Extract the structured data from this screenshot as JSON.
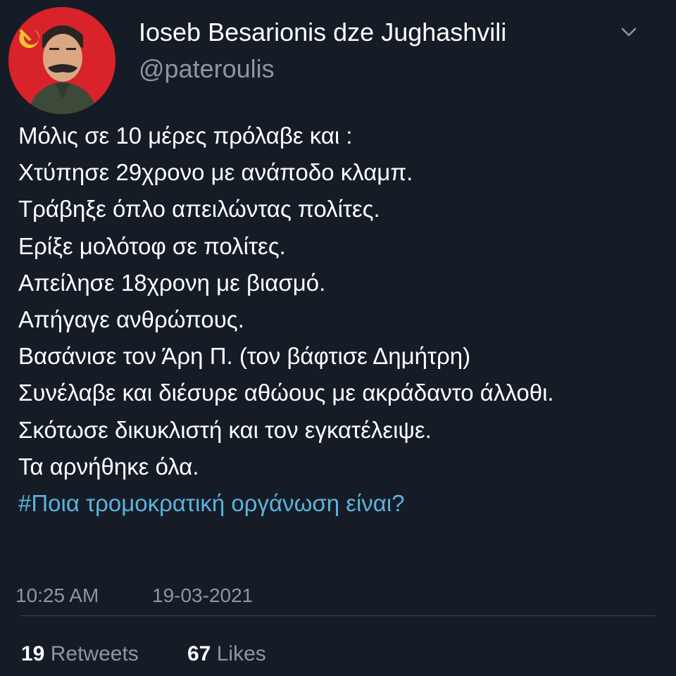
{
  "author": {
    "display_name": "Ioseb Besarionis dze Jughashvili",
    "handle": "@pateroulis",
    "avatar_icon": "profile-portrait-red-background"
  },
  "tweet": {
    "lines": [
      "Μόλις σε 10 μέρες πρόλαβε και :",
      "Χτύπησε 29χρονο με ανάποδο κλαμπ.",
      "Τράβηξε όπλο απειλώντας πολίτες.",
      "Ερίξε μολότοφ σε πολίτες.",
      "Απείλησε 18χρονη με βιασμό.",
      "Απήγαγε ανθρώπους.",
      "Βασάνισε τον Άρη Π. (τον βάφτισε Δημήτρη)",
      "Συνέλαβε και διέσυρε αθώους με ακράδαντο άλλοθι.",
      "Σκότωσε δικυκλιστή και τον εγκατέλειψε.",
      "Τα αρνήθηκε όλα."
    ],
    "hashtag": "#Ποια τρομοκρατική οργάνωση είναι?"
  },
  "meta": {
    "time": "10:25 AM",
    "date": "19-03-2021"
  },
  "stats": {
    "retweets_count": "19",
    "retweets_label": "Retweets",
    "likes_count": "67",
    "likes_label": "Likes"
  },
  "colors": {
    "background": "#151c26",
    "text": "#ffffff",
    "secondary": "#8a98a5",
    "hashtag": "#5bb3dd",
    "divider": "#3b4652"
  }
}
